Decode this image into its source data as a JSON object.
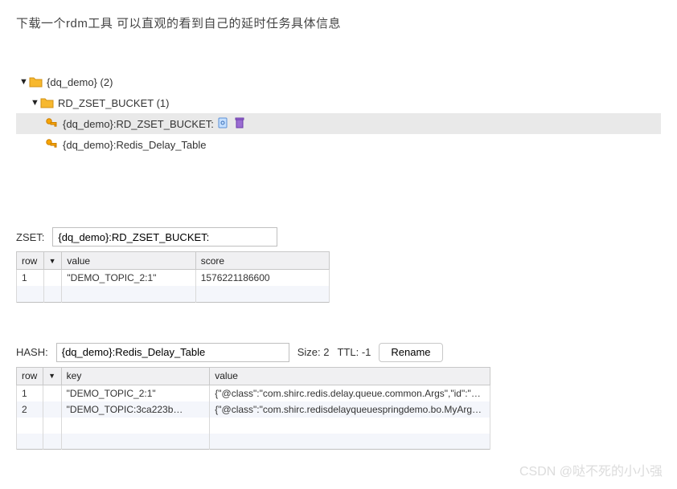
{
  "heading": "下载一个rdm工具 可以直观的看到自己的延时任务具体信息",
  "tree": {
    "root": {
      "label": "{dq_demo} (2)"
    },
    "folder": {
      "label": "RD_ZSET_BUCKET (1)"
    },
    "selected_key": {
      "label": "{dq_demo}:RD_ZSET_BUCKET:"
    },
    "other_key": {
      "label": "{dq_demo}:Redis_Delay_Table"
    }
  },
  "zset": {
    "label": "ZSET:",
    "key_value": "{dq_demo}:RD_ZSET_BUCKET:",
    "headers": {
      "row": "row",
      "value": "value",
      "score": "score"
    },
    "rows": [
      {
        "row": "1",
        "value": "\"DEMO_TOPIC_2:1\"",
        "score": "1576221186600"
      }
    ]
  },
  "hash": {
    "label": "HASH:",
    "key_value": "{dq_demo}:Redis_Delay_Table",
    "size_label": "Size: 2",
    "ttl_label": "TTL: -1",
    "rename_label": "Rename",
    "headers": {
      "row": "row",
      "key": "key",
      "value": "value"
    },
    "rows": [
      {
        "row": "1",
        "key": "\"DEMO_TOPIC_2:1\"",
        "value": "{\"@class\":\"com.shirc.redis.delay.queue.common.Args\",\"id\":\"…"
      },
      {
        "row": "2",
        "key": "\"DEMO_TOPIC:3ca223b…",
        "value": "{\"@class\":\"com.shirc.redisdelayqueuespringdemo.bo.MyArg…"
      }
    ]
  },
  "watermark": "CSDN @哒不死的小小强"
}
